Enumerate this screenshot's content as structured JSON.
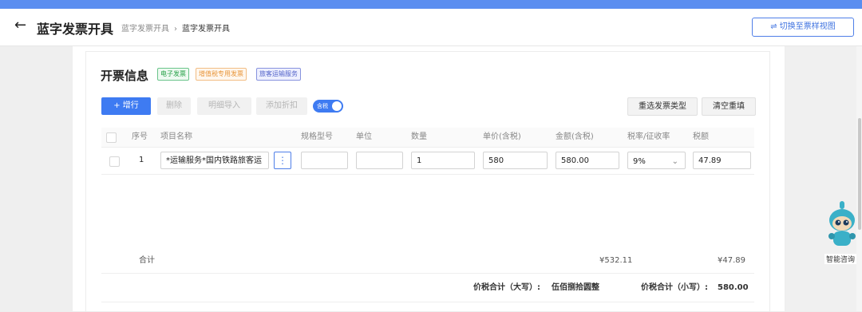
{
  "header": {
    "back_icon": "arrow-left-icon",
    "title": "蓝字发票开具",
    "breadcrumb": [
      "蓝字发票开具",
      "蓝字发票开具"
    ],
    "breadcrumb_sep": "›",
    "switch_view": "切换至票样视图"
  },
  "section": {
    "title": "开票信息",
    "tags": [
      "电子发票",
      "增值税专用发票",
      "旅客运输服务"
    ]
  },
  "toolbar": {
    "add_row": "+ 增行",
    "delete": "删除",
    "import_detail": "明细导入",
    "add_discount": "添加折扣",
    "tax_included": "含税",
    "tax_included_on": true,
    "retype": "重选发票类型",
    "clear": "清空重填"
  },
  "table": {
    "headers": [
      "序号",
      "项目名称",
      "规格型号",
      "单位",
      "数量",
      "单价(含税)",
      "金额(含税)",
      "税率/征收率",
      "税额"
    ],
    "rows": [
      {
        "index": "1",
        "item_name": "*运输服务*国内铁路旅客运",
        "spec": "",
        "unit": "",
        "quantity": "1",
        "unit_price": "580",
        "amount": "580.00",
        "tax_rate": "9%",
        "tax": "47.89"
      }
    ]
  },
  "summary": {
    "label": "合计",
    "amount_total": "¥532.11",
    "tax_total": "¥47.89",
    "total_upper_label": "价税合计（大写）:",
    "total_upper_value": "伍佰捌拾圆整",
    "total_lower_label": "价税合计（小写）:",
    "total_lower_value": "580.00"
  },
  "assistant": {
    "label": "智能咨询"
  },
  "colors": {
    "primary": "#3e7bf2",
    "topbar": "#5b8ef0"
  }
}
